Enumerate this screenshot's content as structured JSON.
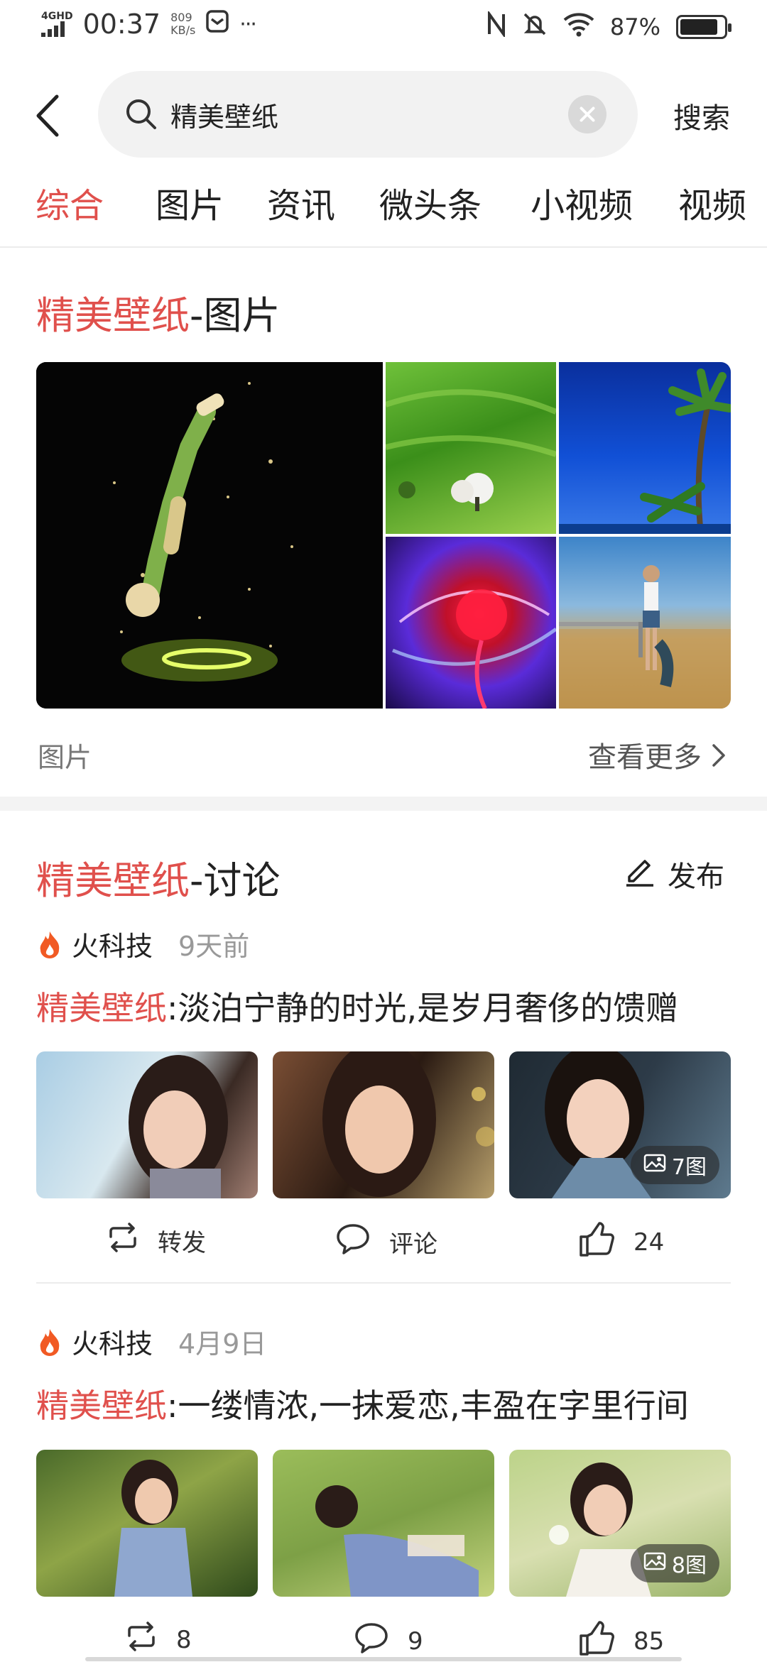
{
  "status_bar": {
    "network": "4GHD",
    "time": "00:37",
    "speed_value": "809",
    "speed_unit": "KB/s",
    "more": "···",
    "battery": "87%",
    "battery_level": 0.87
  },
  "header": {
    "search_value": "精美壁纸",
    "search_button": "搜索"
  },
  "tabs": [
    {
      "label": "综合",
      "active": true
    },
    {
      "label": "图片",
      "active": false
    },
    {
      "label": "资讯",
      "active": false
    },
    {
      "label": "微头条",
      "active": false
    },
    {
      "label": "小视频",
      "active": false
    },
    {
      "label": "视频",
      "active": false
    }
  ],
  "images_section": {
    "title_keyword": "精美壁纸",
    "title_suffix": "-图片",
    "footer_label": "图片",
    "more_label": "查看更多"
  },
  "discussion_section": {
    "title_keyword": "精美壁纸",
    "title_suffix": "-讨论",
    "publish_label": "发布"
  },
  "posts": [
    {
      "author": "火科技",
      "time": "9天前",
      "keyword": "精美壁纸",
      "text": ":淡泊宁静的时光,是岁月奢侈的馈赠",
      "photo_count": "7图",
      "repost": "转发",
      "comment": "评论",
      "likes": "24"
    },
    {
      "author": "火科技",
      "time": "4月9日",
      "keyword": "精美壁纸",
      "text": ":一缕情浓,一抹爱恋,丰盈在字里行间",
      "photo_count": "8图",
      "repost": "8",
      "comment": "9",
      "likes": "85"
    }
  ],
  "colors": {
    "accent": "#e0504c",
    "text": "#222222",
    "muted": "#999999"
  }
}
